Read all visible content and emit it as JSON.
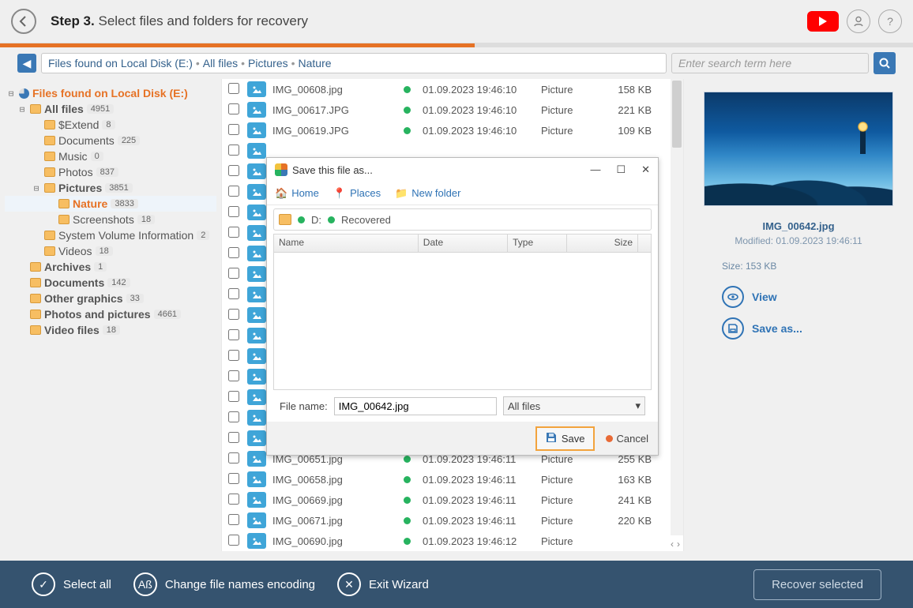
{
  "header": {
    "step": "Step 3.",
    "title": "Select files and folders for recovery"
  },
  "breadcrumb": {
    "root": "Files found on Local Disk (E:)",
    "p1": "All files",
    "p2": "Pictures",
    "p3": "Nature",
    "search_placeholder": "Enter search term here"
  },
  "tree": {
    "root": "Files found on Local Disk (E:)",
    "allfiles": "All files",
    "allfiles_n": "4951",
    "extend": "$Extend",
    "extend_n": "8",
    "documents": "Documents",
    "documents_n": "225",
    "music": "Music",
    "music_n": "0",
    "photos": "Photos",
    "photos_n": "837",
    "pictures": "Pictures",
    "pictures_n": "3851",
    "nature": "Nature",
    "nature_n": "3833",
    "screenshots": "Screenshots",
    "screenshots_n": "18",
    "svi": "System Volume Information",
    "svi_n": "2",
    "videos": "Videos",
    "videos_n": "18",
    "archives": "Archives",
    "archives_n": "1",
    "docs2": "Documents",
    "docs2_n": "142",
    "other": "Other graphics",
    "other_n": "33",
    "pnp": "Photos and pictures",
    "pnp_n": "4661",
    "vf": "Video files",
    "vf_n": "18"
  },
  "rows": [
    {
      "name": "IMG_00608.jpg",
      "date": "01.09.2023 19:46:10",
      "kind": "Picture",
      "size": "158 KB"
    },
    {
      "name": "IMG_00617.JPG",
      "date": "01.09.2023 19:46:10",
      "kind": "Picture",
      "size": "221 KB"
    },
    {
      "name": "IMG_00619.JPG",
      "date": "01.09.2023 19:46:10",
      "kind": "Picture",
      "size": "109 KB"
    },
    {
      "name": "",
      "date": "",
      "kind": "",
      "size": ""
    },
    {
      "name": "",
      "date": "",
      "kind": "",
      "size": ""
    },
    {
      "name": "",
      "date": "",
      "kind": "",
      "size": ""
    },
    {
      "name": "",
      "date": "",
      "kind": "",
      "size": ""
    },
    {
      "name": "",
      "date": "",
      "kind": "",
      "size": ""
    },
    {
      "name": "",
      "date": "",
      "kind": "",
      "size": ""
    },
    {
      "name": "",
      "date": "",
      "kind": "",
      "size": ""
    },
    {
      "name": "",
      "date": "",
      "kind": "",
      "size": ""
    },
    {
      "name": "",
      "date": "",
      "kind": "",
      "size": ""
    },
    {
      "name": "",
      "date": "",
      "kind": "",
      "size": ""
    },
    {
      "name": "",
      "date": "",
      "kind": "",
      "size": ""
    },
    {
      "name": "",
      "date": "",
      "kind": "",
      "size": ""
    },
    {
      "name": "",
      "date": "",
      "kind": "",
      "size": ""
    },
    {
      "name": "",
      "date": "",
      "kind": "",
      "size": ""
    },
    {
      "name": "",
      "date": "",
      "kind": "",
      "size": ""
    },
    {
      "name": "IMG_00651.jpg",
      "date": "01.09.2023 19:46:11",
      "kind": "Picture",
      "size": "255 KB"
    },
    {
      "name": "IMG_00658.jpg",
      "date": "01.09.2023 19:46:11",
      "kind": "Picture",
      "size": "163 KB"
    },
    {
      "name": "IMG_00669.jpg",
      "date": "01.09.2023 19:46:11",
      "kind": "Picture",
      "size": "241 KB"
    },
    {
      "name": "IMG_00671.jpg",
      "date": "01.09.2023 19:46:11",
      "kind": "Picture",
      "size": "220 KB"
    },
    {
      "name": "IMG_00690.jpg",
      "date": "01.09.2023 19:46:12",
      "kind": "Picture",
      "size": ""
    }
  ],
  "side": {
    "filename": "IMG_00642.jpg",
    "modified": "Modified: 01.09.2023 19:46:11",
    "size": "Size: 153 KB",
    "view": "View",
    "saveas": "Save as..."
  },
  "dialog": {
    "title": "Save this file as...",
    "home": "Home",
    "places": "Places",
    "newfolder": "New folder",
    "drive": "D:",
    "folder": "Recovered",
    "col_name": "Name",
    "col_date": "Date",
    "col_type": "Type",
    "col_size": "Size",
    "fn_label": "File name:",
    "fn_value": "IMG_00642.jpg",
    "filter": "All files",
    "save": "Save",
    "cancel": "Cancel"
  },
  "bottom": {
    "selectall": "Select all",
    "encoding": "Change file names encoding",
    "exit": "Exit Wizard",
    "recover": "Recover selected"
  }
}
